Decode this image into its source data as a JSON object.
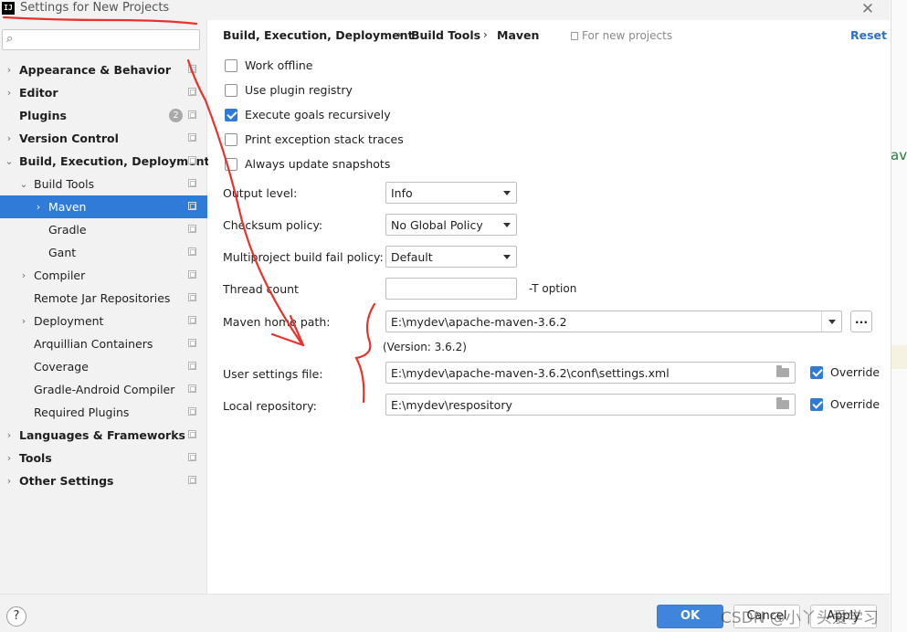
{
  "window": {
    "title": "Settings for New Projects",
    "app_icon": "IJ"
  },
  "search": {
    "placeholder": "",
    "value": ""
  },
  "sidebar": {
    "items": [
      {
        "label": "Appearance & Behavior"
      },
      {
        "label": "Editor"
      },
      {
        "label": "Plugins",
        "badge": "2"
      },
      {
        "label": "Version Control"
      },
      {
        "label": "Build, Execution, Deployment"
      },
      {
        "label": "Build Tools"
      },
      {
        "label": "Maven"
      },
      {
        "label": "Gradle"
      },
      {
        "label": "Gant"
      },
      {
        "label": "Compiler"
      },
      {
        "label": "Remote Jar Repositories"
      },
      {
        "label": "Deployment"
      },
      {
        "label": "Arquillian Containers"
      },
      {
        "label": "Coverage"
      },
      {
        "label": "Gradle-Android Compiler"
      },
      {
        "label": "Required Plugins"
      },
      {
        "label": "Languages & Frameworks"
      },
      {
        "label": "Tools"
      },
      {
        "label": "Other Settings"
      }
    ]
  },
  "breadcrumb": {
    "part1": "Build, Execution, Deployment",
    "part2": "Build Tools",
    "part3": "Maven",
    "separator": "›",
    "scope": "For new projects",
    "reset": "Reset"
  },
  "options": {
    "work_offline": {
      "label": "Work offline",
      "checked": false
    },
    "use_plugin_registry": {
      "label": "Use plugin registry",
      "checked": false
    },
    "execute_goals_recursively": {
      "label": "Execute goals recursively",
      "checked": true
    },
    "print_exception_stack_traces": {
      "label": "Print exception stack traces",
      "checked": false
    },
    "always_update_snapshots": {
      "label": "Always update snapshots",
      "checked": false
    }
  },
  "fields": {
    "output_level": {
      "label": "Output level:",
      "value": "Info"
    },
    "checksum_policy": {
      "label": "Checksum policy:",
      "value": "No Global Policy"
    },
    "fail_policy": {
      "label": "Multiproject build fail policy:",
      "value": "Default"
    },
    "thread_count": {
      "label": "Thread count",
      "value": "",
      "hint": "-T option"
    },
    "maven_home": {
      "label": "Maven home path:",
      "value": "E:\\mydev\\apache-maven-3.6.2",
      "browse": "...",
      "version": "(Version: 3.6.2)"
    },
    "user_settings": {
      "label": "User settings file:",
      "value": "E:\\mydev\\apache-maven-3.6.2\\conf\\settings.xml",
      "override_label": "Override",
      "override": true
    },
    "local_repo": {
      "label": "Local repository:",
      "value": "E:\\mydev\\respository",
      "override_label": "Override",
      "override": true
    }
  },
  "footer": {
    "help": "?",
    "ok": "OK",
    "cancel": "Cancel",
    "apply": "Apply"
  },
  "background": {
    "editor_fragment": "av"
  },
  "watermark": "CSDN @小丫头爱学习",
  "colors": {
    "accent": "#2f7bd7",
    "link": "#2f6fc4",
    "annotation": "#e8322d"
  }
}
